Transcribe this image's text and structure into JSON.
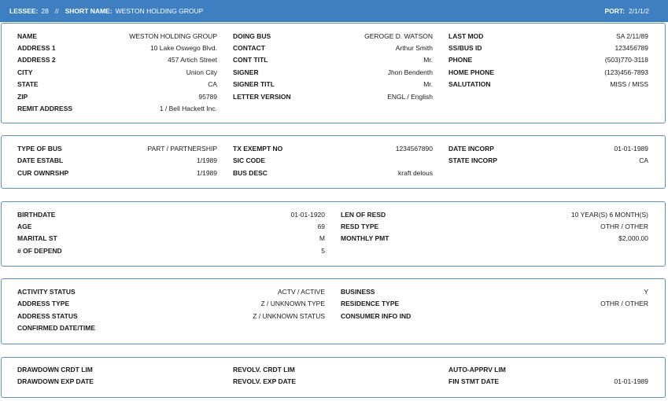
{
  "header": {
    "lessee_label": "LESSEE:",
    "lessee_value": "28",
    "separator": "//",
    "short_name_label": "SHORT NAME:",
    "short_name_value": "WESTON HOLDING GROUP",
    "port_label": "PORT:",
    "port_value": "2/1/1/2"
  },
  "panel1": {
    "col1": [
      {
        "label": "NAME",
        "value": "WESTON HOLDING GROUP"
      },
      {
        "label": "ADDRESS 1",
        "value": "10 Lake Oswego Blvd."
      },
      {
        "label": "ADDRESS 2",
        "value": "457 Artich Street"
      },
      {
        "label": "CITY",
        "value": "Union City"
      },
      {
        "label": "STATE",
        "value": "CA"
      },
      {
        "label": "ZIP",
        "value": "95789"
      },
      {
        "label": "REMIT ADDRESS",
        "value": "1 / Bell Hackett Inc."
      }
    ],
    "col2": [
      {
        "label": "DOING BUS",
        "value": "GEROGE D. WATSON"
      },
      {
        "label": "CONTACT",
        "value": "Arthur Smith"
      },
      {
        "label": "CONT TITL",
        "value": "Mr."
      },
      {
        "label": "SIGNER",
        "value": "Jhon Bendenth"
      },
      {
        "label": "SIGNER TITL",
        "value": "Mr."
      },
      {
        "label": "LETTER VERSION",
        "value": "ENGL / English"
      }
    ],
    "col3": [
      {
        "label": "LAST MOD",
        "value": "SA 2/11/89"
      },
      {
        "label": "SS/BUS ID",
        "value": "123456789"
      },
      {
        "label": "PHONE",
        "value": "(503)770-3118"
      },
      {
        "label": "HOME PHONE",
        "value": "(123)456-7893"
      },
      {
        "label": "SALUTATION",
        "value": "MISS / MISS"
      }
    ]
  },
  "panel2": {
    "col1": [
      {
        "label": "TYPE OF BUS",
        "value": "PART / PARTNERSHIP"
      },
      {
        "label": "DATE ESTABL",
        "value": "1/1989"
      },
      {
        "label": "CUR OWNRSHP",
        "value": "1/1989"
      }
    ],
    "col2": [
      {
        "label": "TX EXEMPT NO",
        "value": "1234567890"
      },
      {
        "label": "SIC CODE",
        "value": ""
      },
      {
        "label": "BUS DESC",
        "value": "kraft delous"
      }
    ],
    "col3": [
      {
        "label": "DATE INCORP",
        "value": "01-01-1989"
      },
      {
        "label": "STATE INCORP",
        "value": "CA"
      }
    ]
  },
  "panel3": {
    "col1": [
      {
        "label": "BIRTHDATE",
        "value": "01-01-1920"
      },
      {
        "label": "AGE",
        "value": "69"
      },
      {
        "label": "MARITAL ST",
        "value": "M"
      },
      {
        "label": "# OF DEPEND",
        "value": "5"
      }
    ],
    "col2": [
      {
        "label": "LEN OF RESD",
        "value": "10 YEAR(S) 6 MONTH(S)"
      },
      {
        "label": "RESD TYPE",
        "value": "OTHR / OTHER"
      },
      {
        "label": "MONTHLY PMT",
        "value": "$2,000.00"
      }
    ]
  },
  "panel4": {
    "col1": [
      {
        "label": "ACTIVITY STATUS",
        "value": "ACTV / ACTIVE"
      },
      {
        "label": "ADDRESS TYPE",
        "value": "Z / UNKNOWN TYPE"
      },
      {
        "label": "ADDRESS STATUS",
        "value": "Z / UNKNOWN STATUS"
      },
      {
        "label": "CONFIRMED DATE/TIME",
        "value": ""
      }
    ],
    "col2": [
      {
        "label": "BUSINESS",
        "value": "Y"
      },
      {
        "label": "RESIDENCE TYPE",
        "value": "OTHR / OTHER"
      },
      {
        "label": "CONSUMER INFO IND",
        "value": ""
      }
    ]
  },
  "panel5": {
    "col1": [
      {
        "label": "DRAWDOWN CRDT LIM",
        "value": ""
      },
      {
        "label": "DRAWDOWN EXP DATE",
        "value": ""
      }
    ],
    "col2": [
      {
        "label": "REVOLV. CRDT LIM",
        "value": ""
      },
      {
        "label": "REVOLV. EXP DATE",
        "value": ""
      }
    ],
    "col3": [
      {
        "label": "AUTO-APPRV LIM",
        "value": ""
      },
      {
        "label": "FIN STMT DATE",
        "value": "01-01-1989"
      }
    ]
  }
}
